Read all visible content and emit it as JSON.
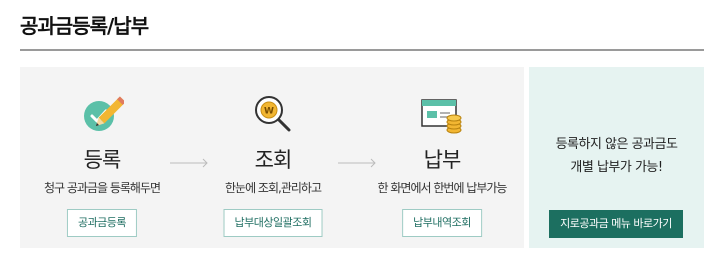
{
  "page": {
    "title": "공과금등록/납부"
  },
  "steps": [
    {
      "title": "등록",
      "description": "청구 공과금을 등록해두면",
      "button": "공과금등록",
      "icon": "check-pencil-icon"
    },
    {
      "title": "조회",
      "description": "한눈에 조회,관리하고",
      "button": "납부대상일괄조회",
      "icon": "won-magnifier-icon"
    },
    {
      "title": "납부",
      "description": "한 화면에서 한번에 납부가능",
      "button": "납부내역조회",
      "icon": "card-coins-icon"
    }
  ],
  "cta": {
    "line1": "등록하지 않은 공과금도",
    "line2": "개별 납부가 가능!",
    "button": "지로공과금 메뉴 바로가기"
  },
  "colors": {
    "accent": "#1c6f60",
    "teal_icon": "#5bc0a8",
    "pencil": "#f2b632",
    "cta_bg": "#e6f3f1",
    "panel_bg": "#f4f4f4"
  }
}
